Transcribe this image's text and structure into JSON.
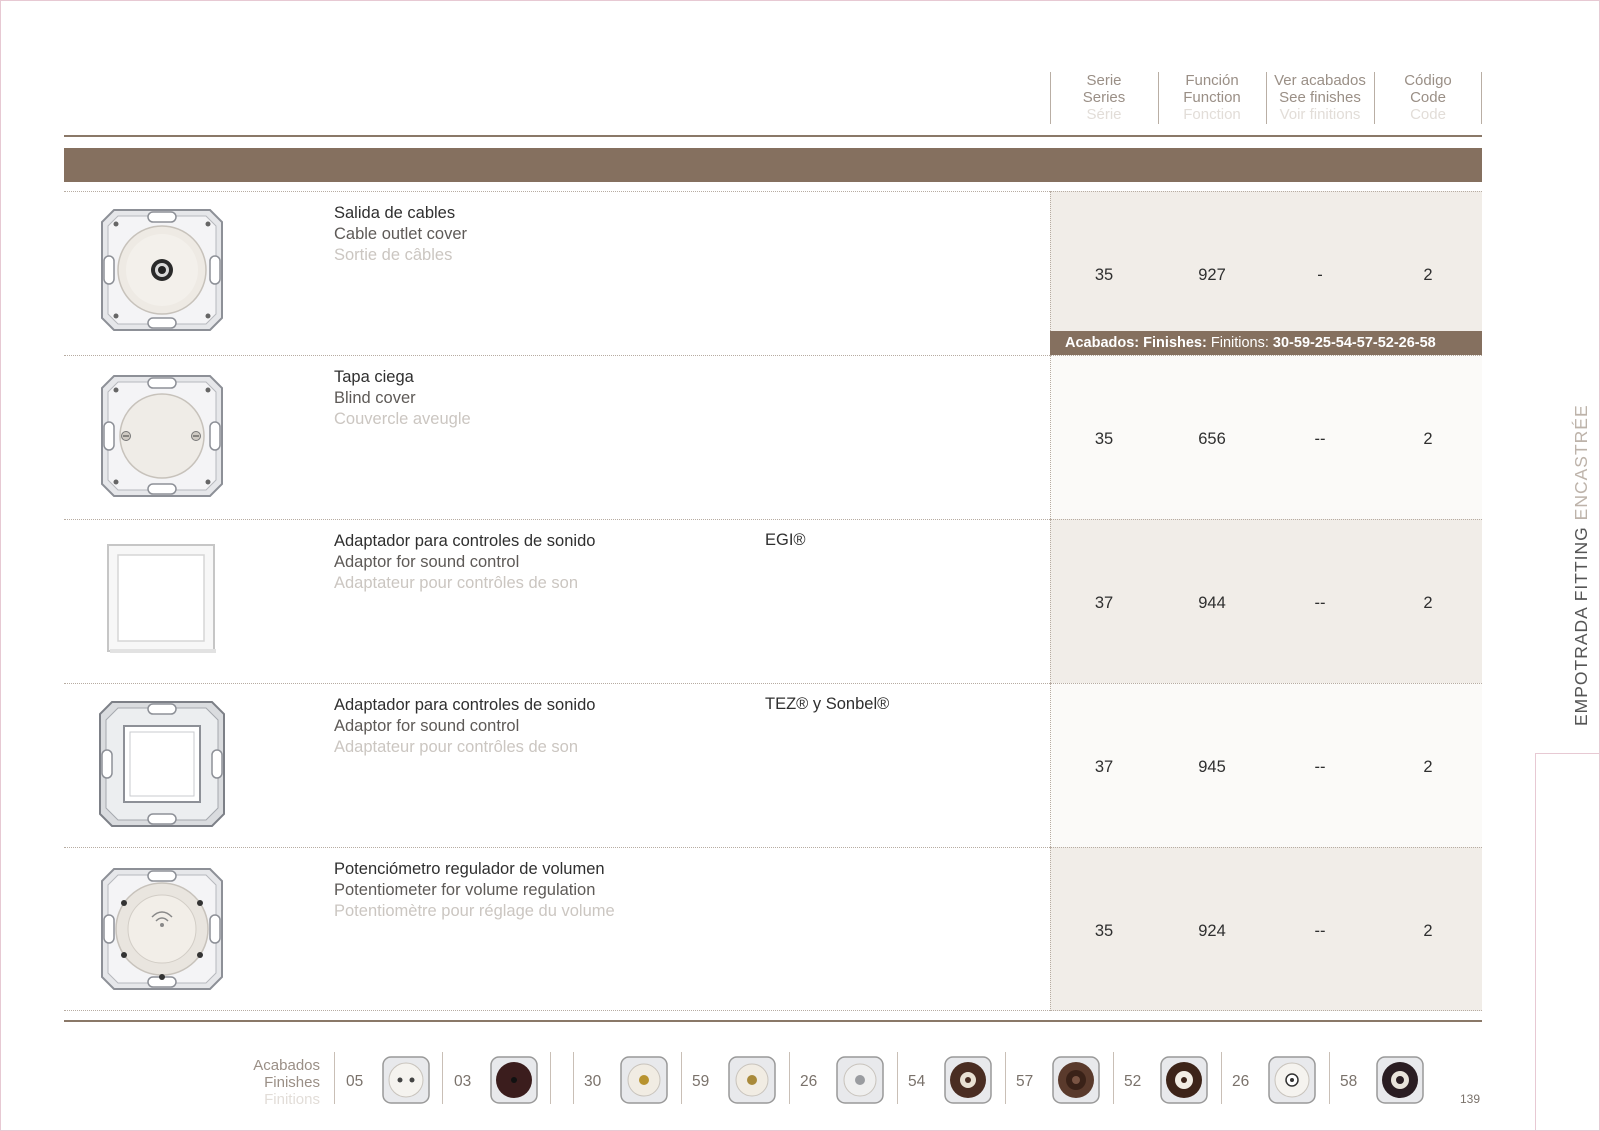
{
  "header": {
    "columns": [
      {
        "es": "Serie",
        "en": "Series",
        "fr": "Série"
      },
      {
        "es": "Función",
        "en": "Function",
        "fr": "Fonction"
      },
      {
        "es": "Ver acabados",
        "en": "See finishes",
        "fr": "Voir finitions"
      },
      {
        "es": "Código",
        "en": "Code",
        "fr": "Code"
      }
    ]
  },
  "products": [
    {
      "es": "Salida de cables",
      "en": "Cable outlet cover",
      "fr": "Sortie de câbles",
      "brand": "",
      "serie": "35",
      "funcion": "927",
      "acabados": "-",
      "codigo": "2"
    },
    {
      "es": "Tapa ciega",
      "en": "Blind cover",
      "fr": "Couvercle aveugle",
      "brand": "",
      "serie": "35",
      "funcion": "656",
      "acabados": "--",
      "codigo": "2"
    },
    {
      "es": "Adaptador para controles de sonido",
      "en": "Adaptor for sound control",
      "fr": "Adaptateur pour contrôles de son",
      "brand": "EGI®",
      "serie": "37",
      "funcion": "944",
      "acabados": "--",
      "codigo": "2"
    },
    {
      "es": "Adaptador para controles de sonido",
      "en": "Adaptor for sound control",
      "fr": "Adaptateur pour contrôles de son",
      "brand": "TEZ® y Sonbel®",
      "serie": "37",
      "funcion": "945",
      "acabados": "--",
      "codigo": "2"
    },
    {
      "es": "Potenciómetro regulador de volumen",
      "en": "Potentiometer for volume regulation",
      "fr": "Potentiomètre pour réglage du volume",
      "brand": "",
      "serie": "35",
      "funcion": "924",
      "acabados": "--",
      "codigo": "2"
    }
  ],
  "finishes_bar": {
    "es": "Acabados:",
    "en": "Finishes:",
    "fr": "Finitions:",
    "codes": "30-59-25-54-57-52-26-58"
  },
  "side_tab": {
    "dark": "EMPOTRADA FITTING",
    "light": "ENCASTRÉE"
  },
  "footer": {
    "label": {
      "es": "Acabados",
      "en": "Finishes",
      "fr": "Finitions"
    },
    "finishes": [
      {
        "code": "05",
        "icon": "white-socket-icon"
      },
      {
        "code": "03",
        "icon": "dark-brown-socket-icon"
      },
      {
        "code": "30",
        "icon": "gold-knob-icon"
      },
      {
        "code": "59",
        "icon": "gold-knob-light-icon"
      },
      {
        "code": "26",
        "icon": "silver-knob-icon"
      },
      {
        "code": "54",
        "icon": "brown-ring-icon"
      },
      {
        "code": "57",
        "icon": "dark-brown-ring-icon"
      },
      {
        "code": "52",
        "icon": "brown-white-ring-icon"
      },
      {
        "code": "26",
        "icon": "white-ring-icon"
      },
      {
        "code": "58",
        "icon": "black-ring-icon"
      }
    ]
  },
  "page_number": "139",
  "colors": {
    "accent": "#85705f",
    "panel_dark": "#f1ede8",
    "panel_light": "#fbfaf8"
  }
}
